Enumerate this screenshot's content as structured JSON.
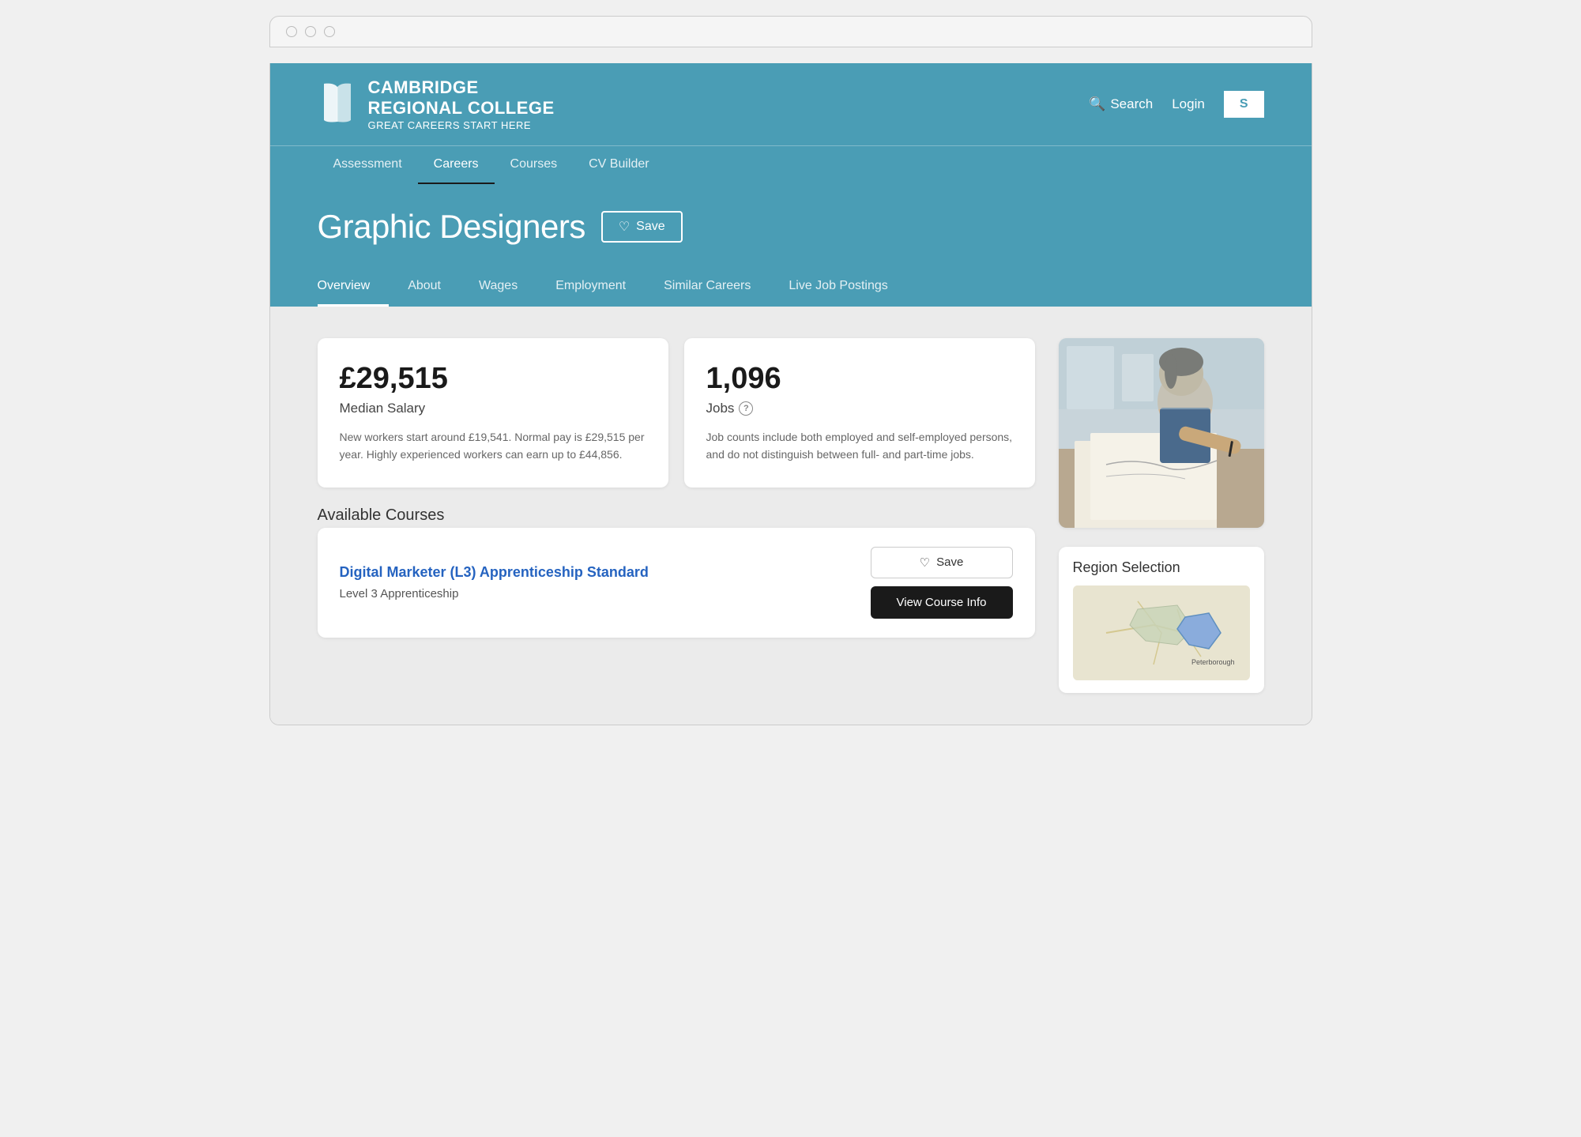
{
  "browser": {
    "dots": [
      "dot1",
      "dot2",
      "dot3"
    ]
  },
  "header": {
    "logo_main": "CAMBRIDGE",
    "logo_line2": "REGIONAL COLLEGE",
    "logo_tagline": "GREAT CAREERS START HERE",
    "search_label": "Search",
    "login_label": "Login",
    "signup_label": "S"
  },
  "nav": {
    "items": [
      {
        "label": "Assessment",
        "active": false
      },
      {
        "label": "Careers",
        "active": true
      },
      {
        "label": "Courses",
        "active": false
      },
      {
        "label": "CV Builder",
        "active": false
      }
    ]
  },
  "career": {
    "title": "Graphic Designers",
    "save_label": "Save"
  },
  "tabs": [
    {
      "label": "Overview",
      "active": true
    },
    {
      "label": "About",
      "active": false
    },
    {
      "label": "Wages",
      "active": false
    },
    {
      "label": "Employment",
      "active": false
    },
    {
      "label": "Similar Careers",
      "active": false
    },
    {
      "label": "Live Job Postings",
      "active": false
    }
  ],
  "stats": {
    "salary": {
      "value": "£29,515",
      "label": "Median Salary",
      "description": "New workers start around £19,541. Normal pay is £29,515 per year. Highly experienced workers can earn up to £44,856."
    },
    "jobs": {
      "value": "1,096",
      "label": "Jobs",
      "description": "Job counts include both employed and self-employed persons, and do not distinguish between full- and part-time jobs."
    }
  },
  "available_courses": {
    "title": "Available Courses",
    "items": [
      {
        "name": "Digital Marketer (L3) Apprenticeship Standard",
        "level": "Level 3 Apprenticeship",
        "save_label": "Save",
        "view_label": "View Course Info"
      }
    ]
  },
  "region": {
    "title": "Region Selection",
    "map_label": "Peterborough"
  }
}
